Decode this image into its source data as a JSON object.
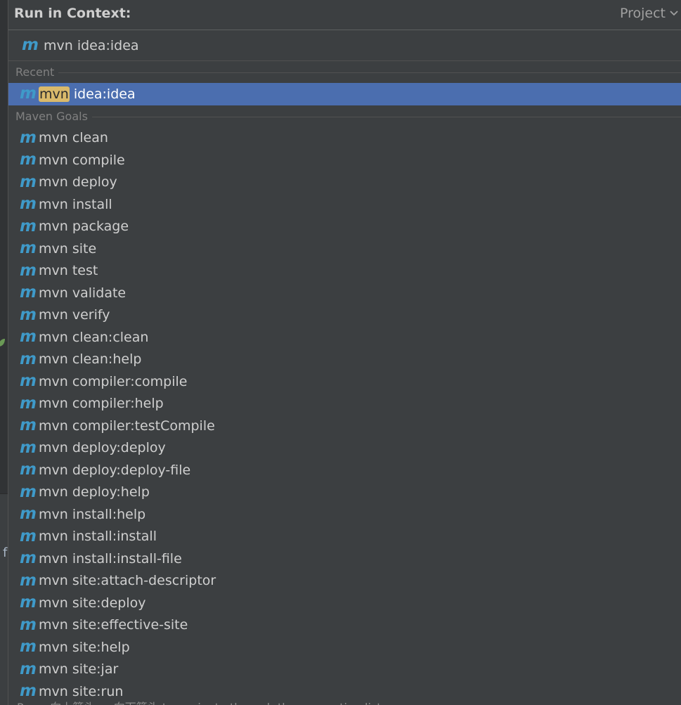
{
  "header": {
    "title": "Run in Context:",
    "scope_label": "Project"
  },
  "search": {
    "value": "mvn idea:idea",
    "icon": "maven-icon"
  },
  "recent": {
    "label": "Recent",
    "items": [
      {
        "match": "mvn",
        "rest": " idea:idea",
        "selected": true
      }
    ]
  },
  "maven_goals": {
    "label": "Maven Goals",
    "items": [
      "mvn clean",
      "mvn compile",
      "mvn deploy",
      "mvn install",
      "mvn package",
      "mvn site",
      "mvn test",
      "mvn validate",
      "mvn verify",
      "mvn clean:clean",
      "mvn clean:help",
      "mvn compiler:compile",
      "mvn compiler:help",
      "mvn compiler:testCompile",
      "mvn deploy:deploy",
      "mvn deploy:deploy-file",
      "mvn deploy:help",
      "mvn install:help",
      "mvn install:install",
      "mvn install:install-file",
      "mvn site:attach-descriptor",
      "mvn site:deploy",
      "mvn site:effective-site",
      "mvn site:help",
      "mvn site:jar",
      "mvn site:run"
    ]
  },
  "footer": {
    "hint": "Press 向上箭头 or 向下箭头 to navigate through the suggestion list"
  },
  "background": {
    "glyph": "f"
  },
  "colors": {
    "background": "#3c3f41",
    "selection": "#4b6eaf",
    "match_highlight": "#d9b96b",
    "maven_icon": "#3f9ac9"
  }
}
